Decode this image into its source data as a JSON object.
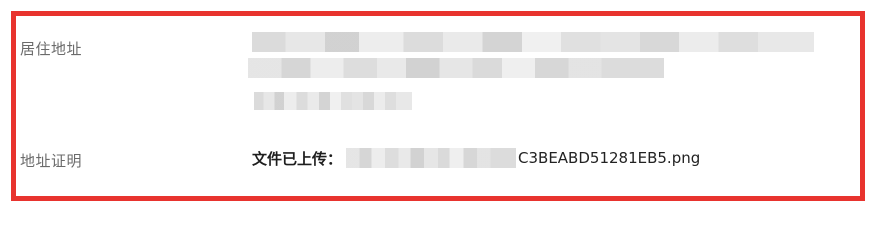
{
  "form": {
    "address": {
      "label": "居住地址"
    },
    "address_proof": {
      "label": "地址证明",
      "upload_prefix": "文件已上传：",
      "filename_suffix": "C3BEABD51281EB5.png"
    }
  },
  "colors": {
    "highlight_border": "#e8332e",
    "label_text": "#6b6b6b",
    "value_text": "#222222"
  }
}
